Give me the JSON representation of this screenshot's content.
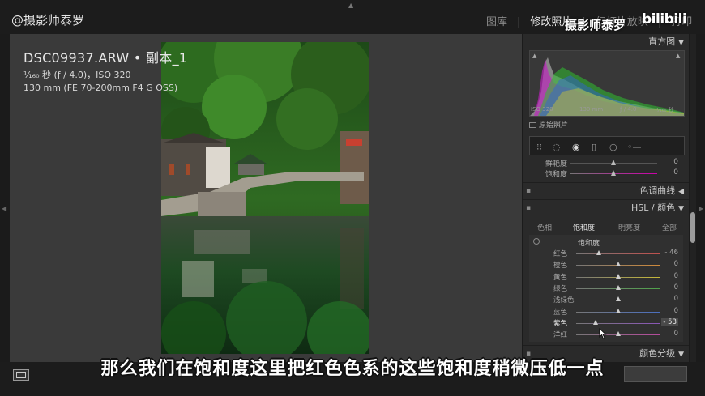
{
  "channel_watermark": "@摄影师泰罗",
  "overlay_brand": {
    "name": "摄影师泰罗",
    "logo": "bilibili"
  },
  "modules": {
    "library": "图库",
    "develop": "修改照片",
    "slideshow": "幻灯片放映",
    "print": "打印",
    "separator": "|"
  },
  "photo_info": {
    "title": "DSC09937.ARW  •  副本_1",
    "exposure": "¹⁄₁₆₀ 秒 (ƒ / 4.0)，ISO 320",
    "lens": "130 mm (FE 70-200mm F4 G OSS)"
  },
  "right_panel": {
    "histogram": {
      "title": "直方图",
      "iso": "ISO 320",
      "focal": "130 mm",
      "aperture": "ƒ / 4.0",
      "shutter": "¹⁄₁₆₀ 秒",
      "original_photo": "原始照片"
    },
    "basic_rows": [
      {
        "label": "鲜艳度",
        "value": "0",
        "position": 0.5
      },
      {
        "label": "饱和度",
        "value": "0",
        "position": 0.5
      }
    ],
    "tone_curve": "色调曲线",
    "hsl_header": "HSL / 颜色",
    "hsl_tabs": [
      "色相",
      "饱和度",
      "明亮度",
      "全部"
    ],
    "hsl_active_tab": "饱和度",
    "hsl_section": "饱和度",
    "hsl_rows": [
      {
        "label": "红色",
        "value": "- 46",
        "position": 0.27,
        "color": "#c0504d"
      },
      {
        "label": "橙色",
        "value": "0",
        "position": 0.5,
        "color": "#d08a3a"
      },
      {
        "label": "黄色",
        "value": "0",
        "position": 0.5,
        "color": "#c7b938"
      },
      {
        "label": "绿色",
        "value": "0",
        "position": 0.5,
        "color": "#4fa34a"
      },
      {
        "label": "浅绿色",
        "value": "0",
        "position": 0.5,
        "color": "#3fb0a8"
      },
      {
        "label": "蓝色",
        "value": "0",
        "position": 0.5,
        "color": "#4a6fc0"
      },
      {
        "label": "紫色",
        "value": "- 53",
        "position": 0.235,
        "color": "#8a56b8"
      },
      {
        "label": "洋红",
        "value": "0",
        "position": 0.5,
        "color": "#b64a9c"
      }
    ],
    "split_toning": "颜色分级"
  },
  "subtitle": "那么我们在饱和度这里把红色色系的这些饱和度稍微压低一点"
}
